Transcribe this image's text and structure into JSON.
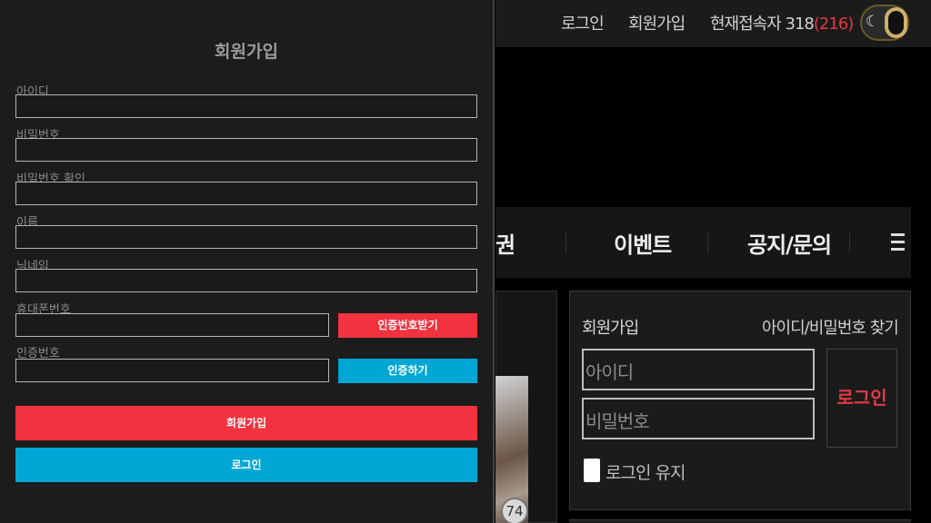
{
  "topbar": {
    "login": "로그인",
    "signup": "회원가입",
    "current_users_label": "현재접속자 318",
    "current_users_highlight": "(216)",
    "theme_icon": "moon-icon"
  },
  "nav": {
    "partial_item": "권",
    "items": [
      "이벤트",
      "공지/문의"
    ],
    "menu_icon": "hamburger-icon"
  },
  "thumbnail": {
    "badge": "74"
  },
  "login_box": {
    "signup_link": "회원가입",
    "find_link": "아이디/비밀번호 찾기",
    "id_placeholder": "아이디",
    "password_placeholder": "비밀번호",
    "login_button": "로그인",
    "remember_label": "로그인 유지"
  },
  "modal": {
    "title": "회원가입",
    "fields": {
      "id": "아이디",
      "password": "비밀번호",
      "password_confirm": "비밀번호 확인",
      "name": "이름",
      "nickname": "닉네임",
      "phone": "휴대폰번호",
      "auth_code": "인증번호"
    },
    "buttons": {
      "request_code": "인증번호받기",
      "verify": "인증하기",
      "submit": "회원가입",
      "login": "로그인"
    }
  },
  "colors": {
    "red": "#f2323f",
    "blue": "#00a7d4",
    "modal_bg": "#1c1c1c"
  }
}
